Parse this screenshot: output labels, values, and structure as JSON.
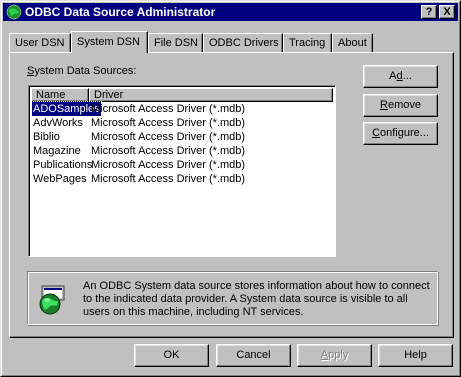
{
  "window": {
    "title": "ODBC Data Source Administrator",
    "help_button": "?",
    "close_button": "X"
  },
  "tabs": [
    {
      "label": "User DSN"
    },
    {
      "label": "System DSN",
      "active": true
    },
    {
      "label": "File DSN"
    },
    {
      "label": "ODBC Drivers"
    },
    {
      "label": "Tracing"
    },
    {
      "label": "About"
    }
  ],
  "list": {
    "group_label_accel": "S",
    "group_label_rest": "ystem Data Sources:",
    "columns": [
      "Name",
      "Driver"
    ],
    "rows": [
      {
        "name": "ADOSamples",
        "driver": "Microsoft Access Driver (*.mdb)",
        "selected": true
      },
      {
        "name": "AdvWorks",
        "driver": "Microsoft Access Driver (*.mdb)"
      },
      {
        "name": "Biblio",
        "driver": "Microsoft Access Driver (*.mdb)"
      },
      {
        "name": "Magazine",
        "driver": "Microsoft Access Driver (*.mdb)"
      },
      {
        "name": "Publications",
        "driver": "Microsoft Access Driver (*.mdb)"
      },
      {
        "name": "WebPages",
        "driver": "Microsoft Access Driver (*.mdb)"
      }
    ]
  },
  "side_buttons": {
    "add": {
      "accel": "d",
      "pre": "A",
      "post": "..."
    },
    "remove": {
      "accel": "R",
      "post": "emove"
    },
    "configure": {
      "accel": "C",
      "post": "onfigure..."
    }
  },
  "info": {
    "text": "An ODBC System data source stores information about how to connect to the indicated data provider.  A System data source is visible to all users on this machine, including NT services.",
    "icon": "odbc-globe-icon"
  },
  "bottom_buttons": {
    "ok": "OK",
    "cancel": "Cancel",
    "apply": {
      "accel": "A",
      "post": "pply",
      "disabled": true
    },
    "help": "Help"
  },
  "colors": {
    "title_bar": "#000080",
    "face": "#c0c0c0",
    "selection": "#000080"
  }
}
